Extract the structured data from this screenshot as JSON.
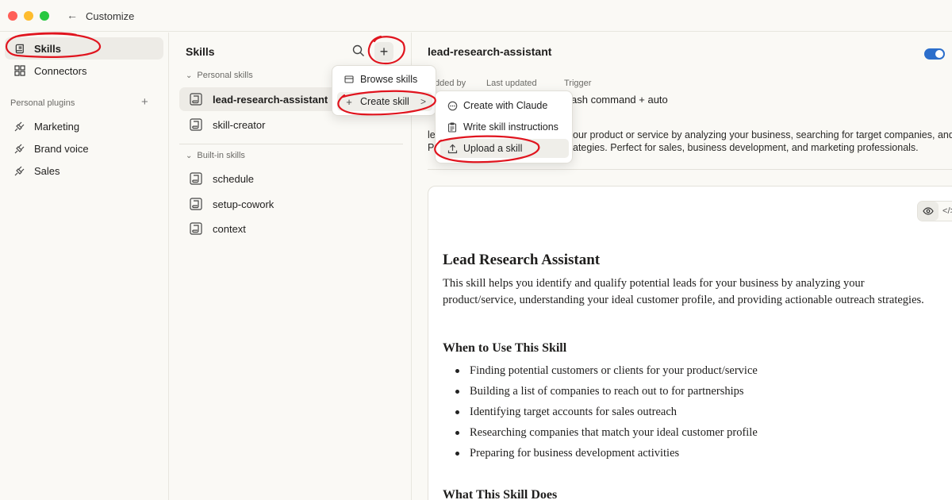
{
  "window": {
    "title": "Customize",
    "back_glyph": "←"
  },
  "sidebar": {
    "items": [
      {
        "label": "Skills",
        "icon": "skill-scroll-icon",
        "active": true
      },
      {
        "label": "Connectors",
        "icon": "connectors-grid-icon",
        "active": false
      }
    ],
    "personal_plugins_label": "Personal plugins",
    "add_plugin_glyph": "+",
    "plugins": [
      {
        "label": "Marketing",
        "icon": "plug-icon"
      },
      {
        "label": "Brand voice",
        "icon": "plug-icon"
      },
      {
        "label": "Sales",
        "icon": "plug-icon"
      }
    ]
  },
  "skills_panel": {
    "title": "Skills",
    "add_glyph": "+",
    "personal_label": "Personal skills",
    "personal": [
      "lead-research-assistant",
      "skill-creator"
    ],
    "builtin_label": "Built-in skills",
    "builtin": [
      "schedule",
      "setup-cowork",
      "context"
    ]
  },
  "detail": {
    "title": "lead-research-assistant",
    "enabled": true,
    "meta": [
      {
        "label": "dded by",
        "value": ""
      },
      {
        "label": "Last updated",
        "value": ""
      },
      {
        "label": "Trigger",
        "value": "ash command + auto"
      }
    ],
    "desc_line1_a": "le",
    "desc_line1_b": "our product or service by analyzing your business, searching for target companies, and",
    "desc_line2_a": "P",
    "desc_line2_b": "ategies. Perfect for sales, business development, and marketing professionals.",
    "view_eye_glyph": "👁",
    "view_code_glyph": "</>"
  },
  "document": {
    "h1": "Lead Research Assistant",
    "intro": "This skill helps you identify and qualify potential leads for your business by analyzing your product/service, understanding your ideal customer profile, and providing actionable outreach strategies.",
    "h2_when": "When to Use This Skill",
    "when_items": [
      "Finding potential customers or clients for your product/service",
      "Building a list of companies to reach out to for partnerships",
      "Identifying target accounts for sales outreach",
      "Researching companies that match your ideal customer profile",
      "Preparing for business development activities"
    ],
    "h2_what": "What This Skill Does"
  },
  "menu_main": {
    "browse": "Browse skills",
    "create": "Create skill",
    "create_chevron": ">"
  },
  "menu_sub": {
    "items": [
      {
        "label": "Create with Claude",
        "icon": "chat-bubble-icon"
      },
      {
        "label": "Write skill instructions",
        "icon": "clipboard-icon"
      },
      {
        "label": "Upload a skill",
        "icon": "upload-icon"
      }
    ]
  },
  "colors": {
    "accent": "#2c6ecb",
    "annotation": "#e0141e",
    "background": "#faf9f5"
  }
}
